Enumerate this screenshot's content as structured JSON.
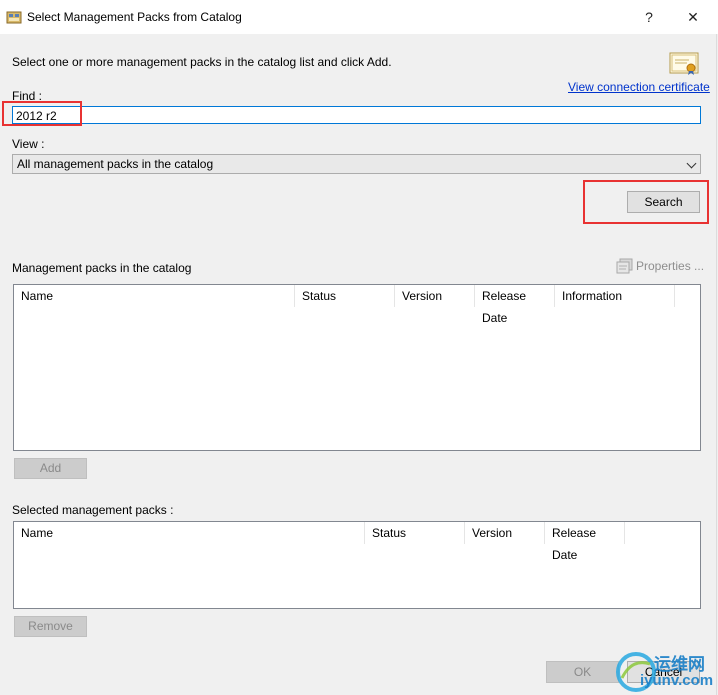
{
  "window": {
    "title": "Select Management Packs from Catalog",
    "help_label": "?",
    "close_label": "✕"
  },
  "instructions": "Select one or more management packs in the catalog list and click Add.",
  "certificate_link": "View connection certificate",
  "find": {
    "label": "Find :",
    "value": "2012 r2"
  },
  "view": {
    "label": "View :",
    "selected": "All management packs in the catalog"
  },
  "search_button": "Search",
  "catalog": {
    "heading": "Management packs in the catalog",
    "properties_label": "Properties ...",
    "columns": [
      "Name",
      "Status",
      "Version",
      "Release Date",
      "Information"
    ],
    "rows": []
  },
  "add_button": "Add",
  "selected": {
    "heading": "Selected management packs :",
    "columns": [
      "Name",
      "Status",
      "Version",
      "Release Date"
    ],
    "rows": []
  },
  "remove_button": "Remove",
  "ok_button": "OK",
  "cancel_button": "Cancel",
  "watermark": {
    "brand_cn": "运维网",
    "brand_url": "iyunv.com"
  },
  "colors": {
    "highlight": "#e83232",
    "link": "#0033cc",
    "focus_border": "#0078d7"
  }
}
